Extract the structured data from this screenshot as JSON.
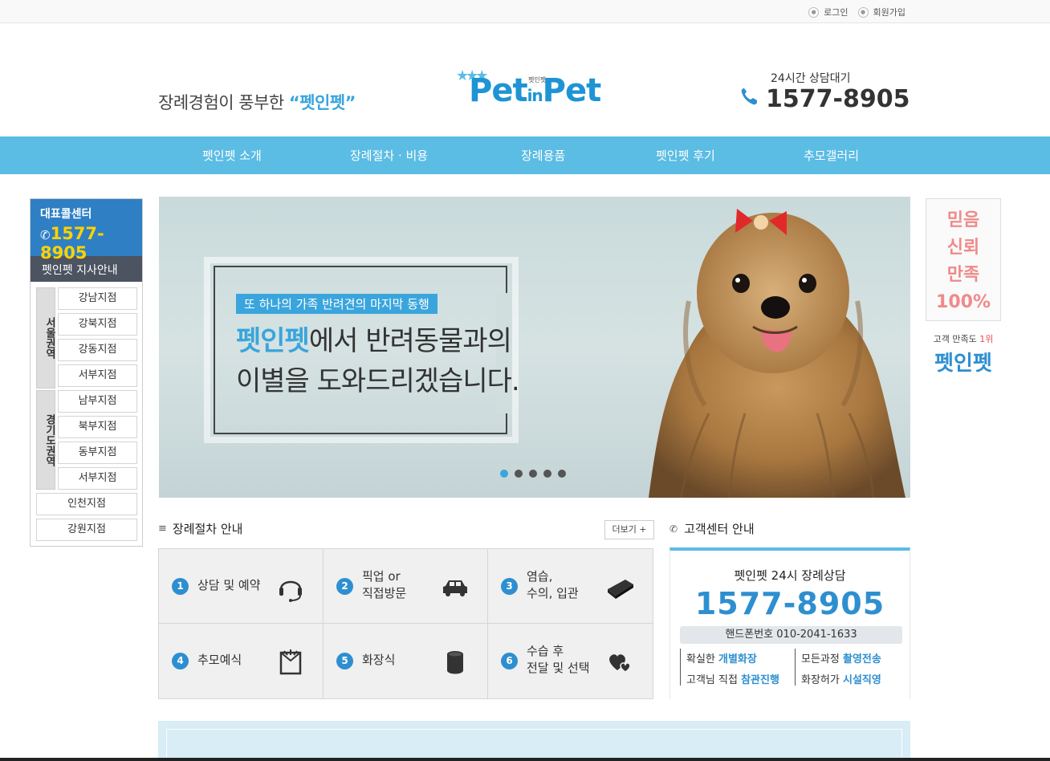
{
  "topbar": {
    "login": "로그인",
    "signup": "회원가입"
  },
  "header": {
    "slogan_prefix": "장례경험이 풍부한 ",
    "slogan_brand": "“펫인펫”",
    "logo_main": "Pet",
    "logo_in": "in",
    "logo_main2": "Pet",
    "logo_small": "펫인펫",
    "hotline_label": "24시간 상담대기",
    "hotline_number": "1577-8905"
  },
  "nav": [
    "펫인펫 소개",
    "장례절차 · 비용",
    "장례용품",
    "펫인펫 후기",
    "추모갤러리"
  ],
  "sidebar": {
    "call_title": "대표콜센터",
    "call_number": "1577-8905",
    "branch_title": "펫인펫 지사안내",
    "region_seoul": "서울권역",
    "region_gyeonggi": "경기도권역",
    "seoul_branches": [
      "강남지점",
      "강북지점",
      "강동지점",
      "서부지점"
    ],
    "gyeonggi_branches": [
      "남부지점",
      "북부지점",
      "동부지점",
      "서부지점"
    ],
    "other_branches": [
      "인천지점",
      "강원지점"
    ]
  },
  "right_banner": {
    "lines": [
      "믿음",
      "신뢰",
      "만족",
      "100%"
    ],
    "rank_text": "고객 만족도 ",
    "rank_value": "1위",
    "brand": "펫인펫"
  },
  "slider": {
    "tag": "또 하나의 가족 반려견의 마지막 동행",
    "headline_brand": "펫인펫",
    "headline_rest": "에서 반려동물과의",
    "headline_line2": "이별을 도와드리겠습니다.",
    "slide_count": 5,
    "active_slide": 1
  },
  "procedure": {
    "title": "장례절차 안내",
    "more": "더보기 +",
    "steps": [
      {
        "num": "1",
        "label": "상담 및 예약",
        "icon": "headset-icon"
      },
      {
        "num": "2",
        "label": "픽업 or\n직접방문",
        "icon": "car-icon"
      },
      {
        "num": "3",
        "label": "염습,\n수의, 입관",
        "icon": "coffin-icon"
      },
      {
        "num": "4",
        "label": "추모예식",
        "icon": "memorial-frame-icon"
      },
      {
        "num": "5",
        "label": "화장식",
        "icon": "urn-icon"
      },
      {
        "num": "6",
        "label": "수습 후\n전달 및 선택",
        "icon": "hearts-icon"
      }
    ]
  },
  "customer_center": {
    "title": "고객센터 안내",
    "line1": "펫인펫 24시 장례상담",
    "number": "1577-8905",
    "mobile": "핸드폰번호 010-2041-1633",
    "features": [
      {
        "prefix": "확실한 ",
        "bold": "개별화장"
      },
      {
        "prefix": "모든과정 ",
        "bold": "촬영전송"
      },
      {
        "prefix": "고객님 직접 ",
        "bold": "참관진행"
      },
      {
        "prefix": "화장허가 ",
        "bold": "시설직영"
      }
    ]
  },
  "colors": {
    "accent": "#5bbce4",
    "brand_blue": "#2e8fd0",
    "highlight_yellow": "#ffd200",
    "pink": "#f08a8a"
  }
}
